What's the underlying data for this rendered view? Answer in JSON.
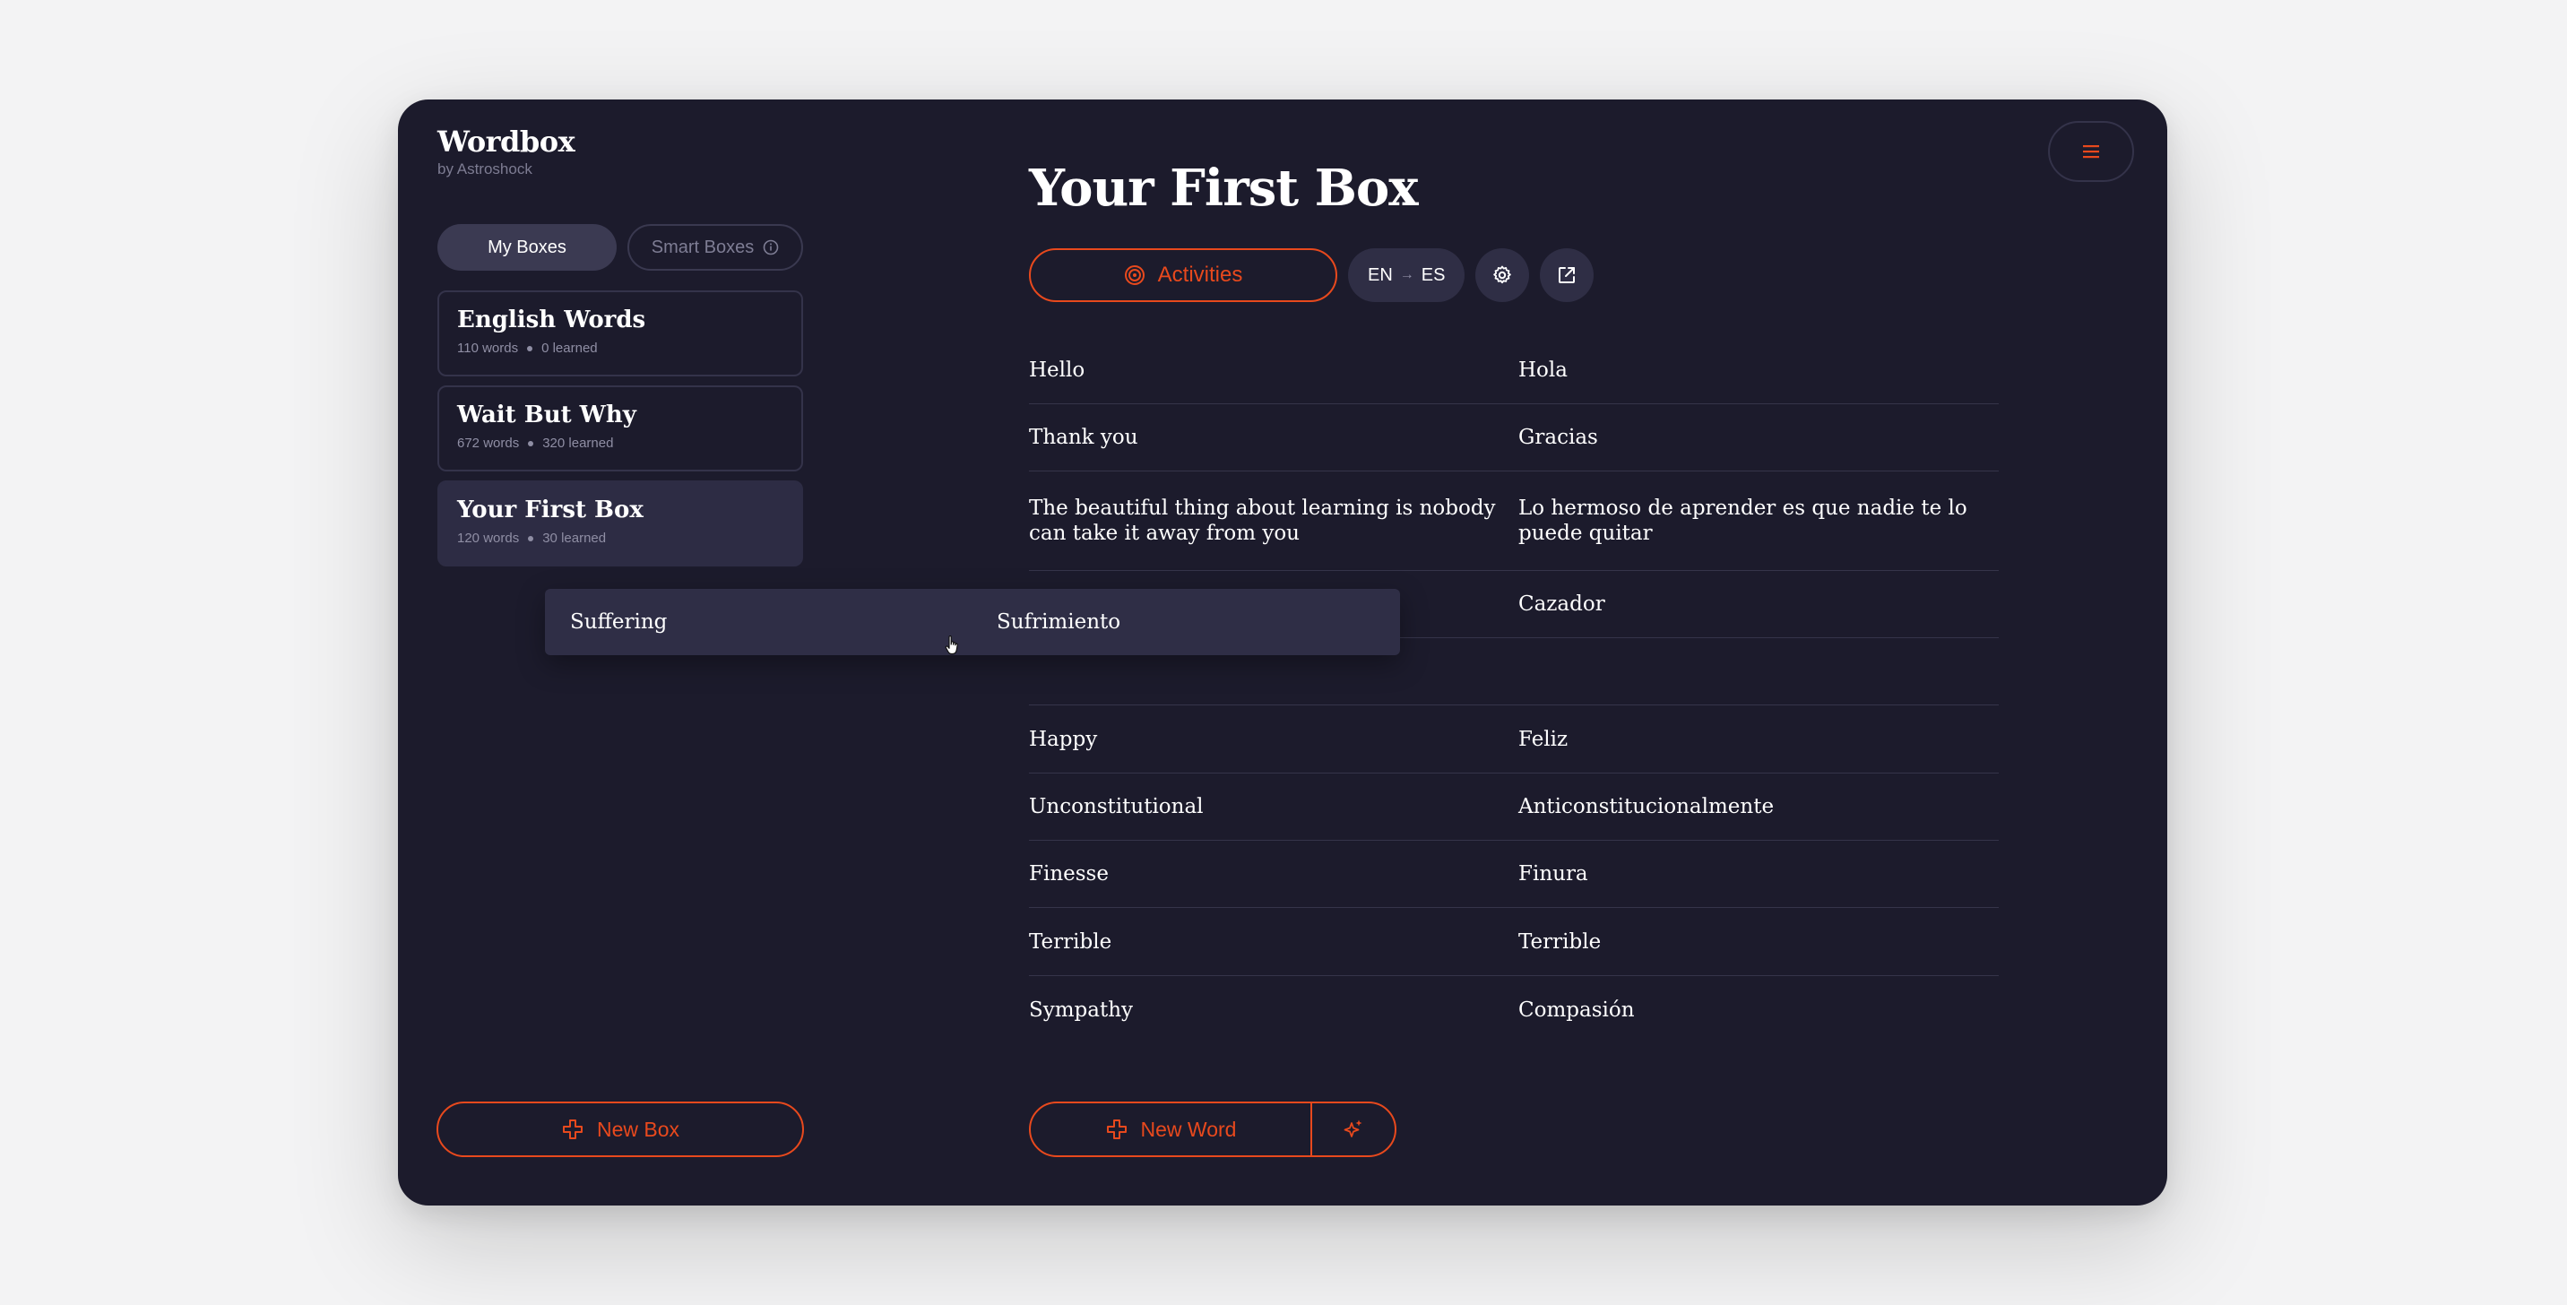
{
  "brand": {
    "title": "Wordbox",
    "subtitle": "by Astroshock"
  },
  "tabs": {
    "my_boxes": "My Boxes",
    "smart_boxes": "Smart Boxes"
  },
  "boxes": [
    {
      "name": "English Words",
      "words": "110 words",
      "learned": "0 learned"
    },
    {
      "name": "Wait But Why",
      "words": "672 words",
      "learned": "320 learned"
    },
    {
      "name": "Your First Box",
      "words": "120 words",
      "learned": "30 learned"
    }
  ],
  "main": {
    "title": "Your First Box",
    "activities_label": "Activities",
    "lang_from": "EN",
    "lang_to": "ES"
  },
  "words": [
    {
      "en": "Hello",
      "es": "Hola"
    },
    {
      "en": "Thank you",
      "es": "Gracias"
    },
    {
      "en": "The beautiful thing about learning is nobody can take it away from you",
      "es": "Lo hermoso de aprender es que nadie te lo puede quitar"
    },
    {
      "en": "",
      "es": "Cazador"
    },
    {
      "en": "",
      "es": ""
    },
    {
      "en": "Happy",
      "es": "Feliz"
    },
    {
      "en": "Unconstitutional",
      "es": "Anticonstitucionalmente"
    },
    {
      "en": "Finesse",
      "es": "Finura"
    },
    {
      "en": "Terrible",
      "es": "Terrible"
    },
    {
      "en": "Sympathy",
      "es": "Compasión"
    }
  ],
  "dragged": {
    "en": "Suffering",
    "es": "Sufrimiento"
  },
  "buttons": {
    "new_box": "New Box",
    "new_word": "New Word"
  },
  "colors": {
    "accent": "#e8491d",
    "background": "#1c1b2c",
    "selected": "#2d2c44"
  },
  "icons": [
    "menu-icon",
    "info-icon",
    "target-icon",
    "gear-icon",
    "external-link-icon",
    "plus-icon",
    "sparkle-icon",
    "hand-cursor-icon"
  ]
}
